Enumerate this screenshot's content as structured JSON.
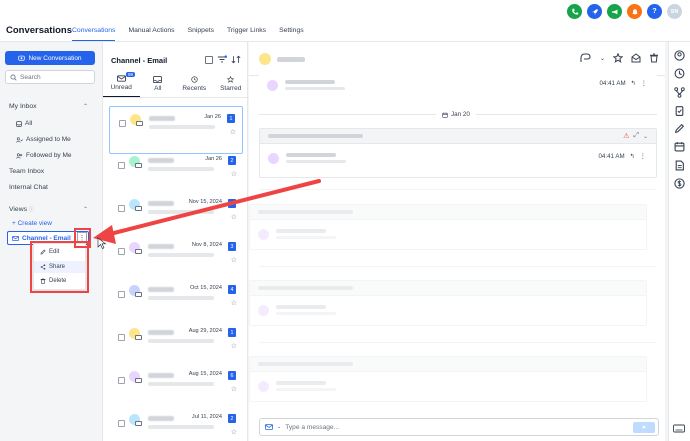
{
  "app": {
    "title": "Conversations"
  },
  "nav_tabs": [
    {
      "label": "Conversations",
      "active": true
    },
    {
      "label": "Manual Actions",
      "active": false
    },
    {
      "label": "Snippets",
      "active": false
    },
    {
      "label": "Trigger Links",
      "active": false
    },
    {
      "label": "Settings",
      "active": false
    }
  ],
  "top_icons": [
    {
      "name": "phone-icon",
      "color": "#16a34a",
      "glyph": "✆"
    },
    {
      "name": "rocket-icon",
      "color": "#2563eb",
      "glyph": "➚"
    },
    {
      "name": "megaphone-icon",
      "color": "#16a34a",
      "glyph": "📢"
    },
    {
      "name": "bell-icon",
      "color": "#f97316",
      "glyph": "🔔"
    },
    {
      "name": "help-icon",
      "color": "#2563eb",
      "glyph": "?"
    }
  ],
  "user": {
    "initials": "SN"
  },
  "sidebar": {
    "new_conversation": "New Conversation",
    "search_placeholder": "Search",
    "my_inbox": "My Inbox",
    "items": [
      "All",
      "Assigned to Me",
      "Followed by Me"
    ],
    "team_inbox": "Team Inbox",
    "internal_chat": "Internal Chat",
    "views": "Views",
    "create_view": "+ Create view",
    "channel_view": "Channel - Email",
    "menu": [
      "Edit",
      "Share",
      "Delete"
    ]
  },
  "list": {
    "title": "Channel - Email",
    "filters": [
      {
        "label": "Unread",
        "active": true,
        "badge": "99"
      },
      {
        "label": "All",
        "active": false
      },
      {
        "label": "Recents",
        "active": false
      },
      {
        "label": "Starred",
        "active": false
      }
    ],
    "items": [
      {
        "date": "Jan 26",
        "count": "1",
        "avatar": "#fde68a",
        "selected": true
      },
      {
        "date": "Jan 26",
        "count": "2",
        "avatar": "#a7f3d0",
        "selected": false
      },
      {
        "date": "Nov 15, 2024",
        "count": "4",
        "avatar": "#bae6fd",
        "selected": false
      },
      {
        "date": "Nov 8, 2024",
        "count": "3",
        "avatar": "#e9d5ff",
        "selected": false
      },
      {
        "date": "Oct 15, 2024",
        "count": "4",
        "avatar": "#c7d2fe",
        "selected": false
      },
      {
        "date": "Aug 29, 2024",
        "count": "1",
        "avatar": "#fde68a",
        "selected": false
      },
      {
        "date": "Aug 15, 2024",
        "count": "6",
        "avatar": "#e9d5ff",
        "selected": false
      },
      {
        "date": "Jul 11, 2024",
        "count": "2",
        "avatar": "#bae6fd",
        "selected": false
      }
    ]
  },
  "conversation": {
    "messages": [
      {
        "time": "04:41 AM"
      },
      {
        "time": "04:41 AM"
      }
    ],
    "date_divider": "Jan 20",
    "compose_placeholder": "Type a message..."
  }
}
